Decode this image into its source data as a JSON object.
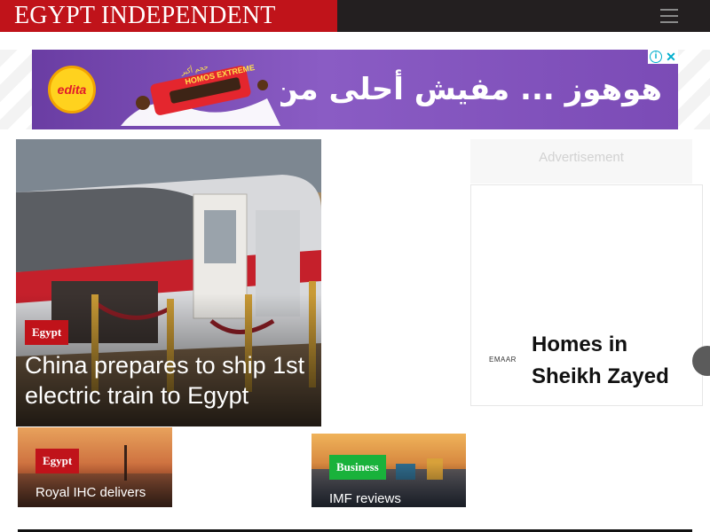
{
  "header": {
    "logo_text": "EGYPT INDEPENDENT",
    "menu_icon": "hamburger-menu-icon",
    "brand_color": "#c0131a",
    "bar_color": "#231f20"
  },
  "top_ad": {
    "brand": "edita",
    "product": "HOMOS EXTREME",
    "product_tag": "حجم أكبر",
    "slogan": "هوهوز ... مفيش أحلى من كده",
    "info_icon": "adchoices-info-icon",
    "close_icon": "close-icon"
  },
  "featured": {
    "category": "Egypt",
    "title": "China prepares to ship 1st electric train to Egypt"
  },
  "sidebar": {
    "ad_label": "Advertisement",
    "ad_brand": "EMAAR",
    "ad_headline": "Homes in Sheikh Zayed",
    "next_icon": "carousel-next-icon"
  },
  "stories": [
    {
      "category": "Egypt",
      "title": "Royal IHC delivers",
      "category_color": "#c0131a"
    },
    {
      "category": "Business",
      "title": "IMF reviews",
      "category_color": "#19b23b"
    }
  ]
}
